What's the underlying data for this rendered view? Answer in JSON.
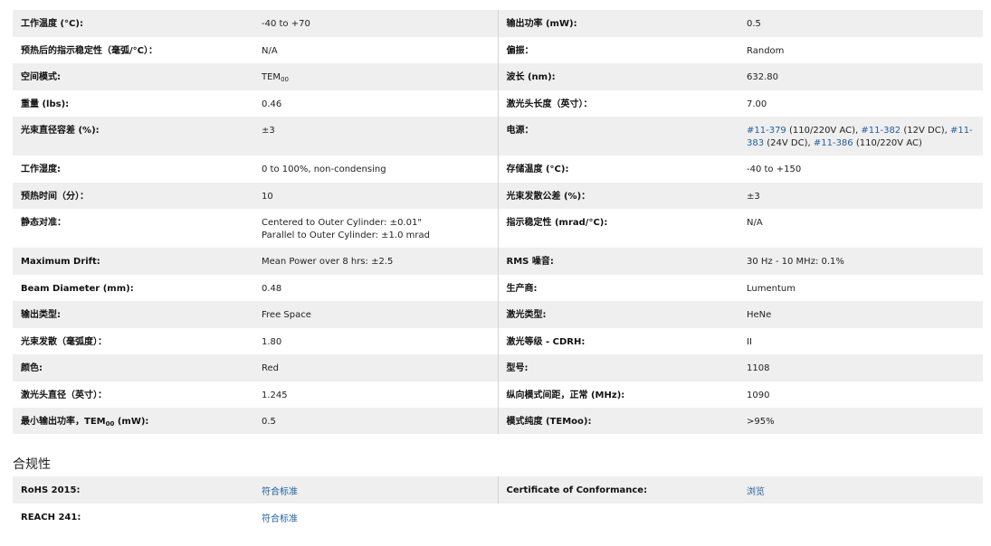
{
  "specs": {
    "rows": [
      {
        "l1": "工作温度 (°C):",
        "v1": "-40 to +70",
        "l2": "输出功率 (mW):",
        "v2": "0.5"
      },
      {
        "l1": "预热后的指示稳定性（毫弧/°C）：",
        "v1": "N/A",
        "l2": "偏振：",
        "v2": "Random"
      },
      {
        "l1": "空间模式:",
        "v1_main": "TEM",
        "v1_sub": "00",
        "l2": "波长 (nm):",
        "v2": "632.80"
      },
      {
        "l1": "重量 (lbs):",
        "v1": "0.46",
        "l2": "激光头长度（英寸）：",
        "v2": "7.00"
      },
      {
        "l1": "光束直径容差 (%):",
        "v1": "±3",
        "l2": "电源：",
        "power": {
          "link1": "#11-379",
          "text1": " (110/220V AC), ",
          "link2": "#11-382",
          "text2": " (12V DC), ",
          "link3": "#11-383",
          "text3": " (24V DC), ",
          "link4": "#11-386",
          "text4": " (110/220V AC)"
        }
      },
      {
        "l1": "工作湿度:",
        "v1": "0 to 100%, non-condensing",
        "l2": "存储温度 (°C):",
        "v2": "-40 to +150"
      },
      {
        "l1": "预热时间（分）：",
        "v1": "10",
        "l2": "光束发散公差 (%)：",
        "v2": "±3"
      },
      {
        "l1": "静态对准：",
        "v1a": "Centered to Outer Cylinder: ±0.01\"",
        "v1b": "Parallel to Outer Cylinder: ±1.0 mrad",
        "l2": "指示稳定性 (mrad/°C):",
        "v2": "N/A"
      },
      {
        "l1": "Maximum Drift:",
        "v1": "Mean Power over 8 hrs: ±2.5",
        "l2": "RMS 噪音:",
        "v2": "30 Hz - 10 MHz: 0.1%"
      },
      {
        "l1": "Beam Diameter (mm):",
        "v1": "0.48",
        "l2": "生产商:",
        "v2": "Lumentum"
      },
      {
        "l1": "输出类型:",
        "v1": "Free Space",
        "l2": "激光类型:",
        "v2": "HeNe"
      },
      {
        "l1": "光束发散（毫弧度）：",
        "v1": "1.80",
        "l2": "激光等级 - CDRH:",
        "v2": "II"
      },
      {
        "l1": "颜色:",
        "v1": "Red",
        "l2": "型号:",
        "v2": "1108"
      },
      {
        "l1": "激光头直径（英寸）：",
        "v1": "1.245",
        "l2": "纵向模式间距，正常 (MHz):",
        "v2": "1090"
      },
      {
        "l1_main": "最小输出功率，TEM",
        "l1_sub": "00",
        "l1_tail": " (mW):",
        "v1": "0.5",
        "l2": "模式纯度 (TEMoo):",
        "v2": ">95%"
      }
    ]
  },
  "compliance": {
    "title": "合规性",
    "rohs_label": "RoHS 2015:",
    "rohs_value": "符合标准",
    "coc_label": "Certificate of Conformance:",
    "coc_value": "浏览",
    "reach_label": "REACH 241:",
    "reach_value": "符合标准"
  },
  "colors": {
    "shade": "#efefef",
    "link": "#1f5f9e"
  }
}
